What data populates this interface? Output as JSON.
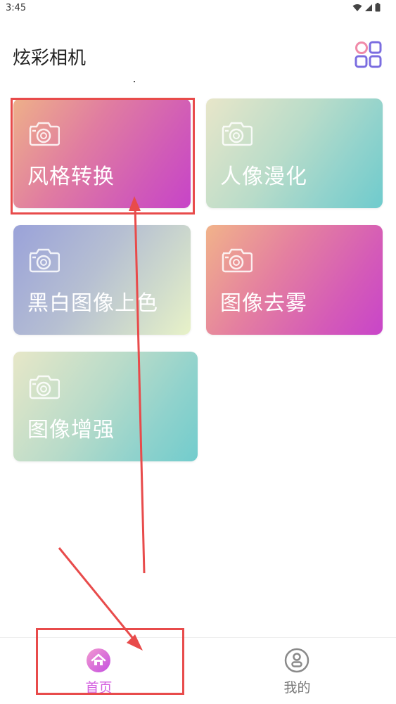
{
  "status_bar": {
    "time": "3:45",
    "icons": [
      "wifi-icon",
      "signal-icon",
      "battery-icon"
    ]
  },
  "header": {
    "title": "炫彩相机",
    "grid_icon": "grid-apps-icon",
    "grid_icon_colors": [
      "#f08aa8",
      "#7b6de0"
    ]
  },
  "cards": [
    {
      "label": "风格转换",
      "icon": "camera-icon"
    },
    {
      "label": "人像漫化",
      "icon": "camera-icon"
    },
    {
      "label": "黑白图像上色",
      "icon": "camera-icon"
    },
    {
      "label": "图像去雾",
      "icon": "camera-icon"
    },
    {
      "label": "图像增强",
      "icon": "camera-icon"
    }
  ],
  "bottom_nav": {
    "items": [
      {
        "label": "首页",
        "icon": "home-icon",
        "active": true,
        "color": "#d45fe0"
      },
      {
        "label": "我的",
        "icon": "user-icon",
        "active": false,
        "color": "#777777"
      }
    ]
  },
  "annotation_color": "#e84b4b"
}
